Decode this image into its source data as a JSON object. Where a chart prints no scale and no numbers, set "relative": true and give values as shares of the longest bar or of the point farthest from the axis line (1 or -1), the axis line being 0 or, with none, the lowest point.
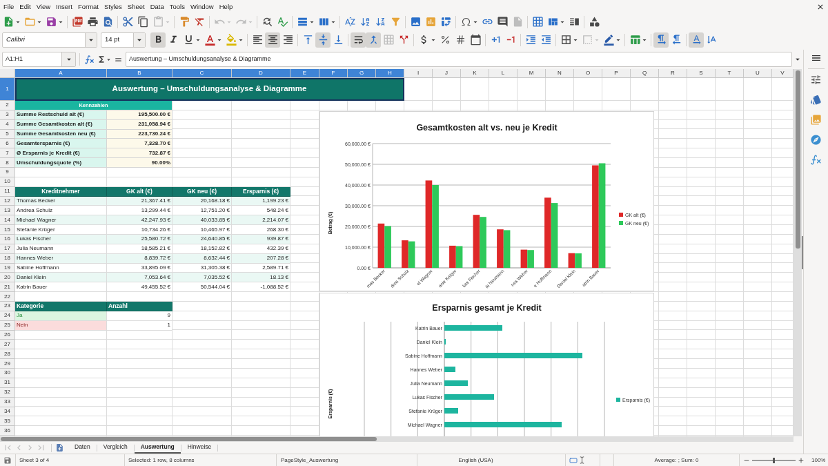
{
  "menu": [
    "File",
    "Edit",
    "View",
    "Insert",
    "Format",
    "Styles",
    "Sheet",
    "Data",
    "Tools",
    "Window",
    "Help"
  ],
  "standard_toolbar": {
    "paste_disabled": true,
    "undo_disabled": true,
    "redo_disabled": true,
    "headers_footers_disabled": true
  },
  "formatting_toolbar": {
    "font_name": "Calibri",
    "font_size": "14 pt",
    "bold": true,
    "italic": false,
    "underline": false,
    "align_left": false,
    "align_center": true,
    "align_right": false,
    "align_top": false,
    "align_middle": true,
    "align_bottom": false,
    "wrap_text": true,
    "merge_and_center": true,
    "merge_disabled": true,
    "border_style_disabled": true,
    "left_to_right": true,
    "right_to_left": false,
    "text_horizontal": true,
    "text_vertical": false
  },
  "formula_bar": {
    "name_box": "A1:H1",
    "content": "Auswertung – Umschuldungsanalyse & Diagramme"
  },
  "sheet": {
    "column_headers": [
      {
        "label": "A",
        "selected": true
      },
      {
        "label": "B",
        "selected": true
      },
      {
        "label": "C",
        "selected": true
      },
      {
        "label": "D",
        "selected": true
      },
      {
        "label": "E",
        "selected": true
      },
      {
        "label": "F",
        "selected": true
      },
      {
        "label": "G",
        "selected": true
      },
      {
        "label": "H",
        "selected": true
      },
      {
        "label": "I",
        "selected": false
      },
      {
        "label": "J",
        "selected": false
      },
      {
        "label": "K",
        "selected": false
      },
      {
        "label": "L",
        "selected": false
      },
      {
        "label": "M",
        "selected": false
      },
      {
        "label": "N",
        "selected": false
      },
      {
        "label": "O",
        "selected": false
      },
      {
        "label": "P",
        "selected": false
      },
      {
        "label": "Q",
        "selected": false
      },
      {
        "label": "R",
        "selected": false
      },
      {
        "label": "S",
        "selected": false
      },
      {
        "label": "T",
        "selected": false
      },
      {
        "label": "U",
        "selected": false
      },
      {
        "label": "V",
        "selected": false
      }
    ],
    "row_headers": [
      {
        "label": "1",
        "selected": true
      },
      {
        "label": "2",
        "selected": false
      },
      {
        "label": "3",
        "selected": false
      },
      {
        "label": "4",
        "selected": false
      },
      {
        "label": "5",
        "selected": false
      },
      {
        "label": "6",
        "selected": false
      },
      {
        "label": "7",
        "selected": false
      },
      {
        "label": "8",
        "selected": false
      },
      {
        "label": "9",
        "selected": false
      },
      {
        "label": "10",
        "selected": false
      },
      {
        "label": "11",
        "selected": false
      },
      {
        "label": "12",
        "selected": false
      },
      {
        "label": "13",
        "selected": false
      },
      {
        "label": "14",
        "selected": false
      },
      {
        "label": "15",
        "selected": false
      },
      {
        "label": "16",
        "selected": false
      },
      {
        "label": "17",
        "selected": false
      },
      {
        "label": "18",
        "selected": false
      },
      {
        "label": "19",
        "selected": false
      },
      {
        "label": "20",
        "selected": false
      },
      {
        "label": "21",
        "selected": false
      },
      {
        "label": "22",
        "selected": false
      },
      {
        "label": "23",
        "selected": false
      },
      {
        "label": "24",
        "selected": false
      },
      {
        "label": "25",
        "selected": false
      },
      {
        "label": "26",
        "selected": false
      },
      {
        "label": "27",
        "selected": false
      },
      {
        "label": "28",
        "selected": false
      },
      {
        "label": "29",
        "selected": false
      },
      {
        "label": "30",
        "selected": false
      },
      {
        "label": "31",
        "selected": false
      },
      {
        "label": "32",
        "selected": false
      },
      {
        "label": "33",
        "selected": false
      },
      {
        "label": "34",
        "selected": false
      },
      {
        "label": "35",
        "selected": false
      },
      {
        "label": "36",
        "selected": false
      }
    ],
    "title": "Auswertung – Umschuldungsanalyse & Diagramme",
    "key_figures": {
      "header": "Kennzahlen",
      "rows": [
        {
          "label": "Summe Restschuld alt (€)",
          "value": "195,500.00 €"
        },
        {
          "label": "Summe Gesamtkosten alt (€)",
          "value": "231,058.94 €"
        },
        {
          "label": "Summe Gesamtkosten neu (€)",
          "value": "223,730.24 €"
        },
        {
          "label": "Gesamtersparnis (€)",
          "value": "7,328.70 €"
        },
        {
          "label": "Ø Ersparnis je Kredit (€)",
          "value": "732.87 €"
        },
        {
          "label": "Umschuldungsquote (%)",
          "value": "90.00%"
        }
      ]
    },
    "loan_table": {
      "columns": [
        "Kreditnehmer",
        "GK alt (€)",
        "GK neu (€)",
        "Ersparnis (€)"
      ],
      "rows": [
        [
          "Thomas Becker",
          "21,367.41 €",
          "20,168.18 €",
          "1,199.23 €"
        ],
        [
          "Andrea Schulz",
          "13,299.44 €",
          "12,751.20 €",
          "548.24 €"
        ],
        [
          "Michael Wagner",
          "42,247.93 €",
          "40,033.85 €",
          "2,214.07 €"
        ],
        [
          "Stefanie Krüger",
          "10,734.26 €",
          "10,465.97 €",
          "268.30 €"
        ],
        [
          "Lukas Fischer",
          "25,580.72 €",
          "24,640.85 €",
          "939.87 €"
        ],
        [
          "Julia Neumann",
          "18,585.21 €",
          "18,152.82 €",
          "432.39 €"
        ],
        [
          "Hannes Weber",
          "8,839.72 €",
          "8,632.44 €",
          "207.28 €"
        ],
        [
          "Sabine Hoffmann",
          "33,895.09 €",
          "31,305.38 €",
          "2,589.71 €"
        ],
        [
          "Daniel Klein",
          "7,053.64 €",
          "7,035.52 €",
          "18.13 €"
        ],
        [
          "Katrin Bauer",
          "49,455.52 €",
          "50,544.04 €",
          "-1,088.52 €"
        ]
      ]
    },
    "category_table": {
      "columns": [
        "Kategorie",
        "Anzahl"
      ],
      "rows": [
        {
          "label": "Ja",
          "value": "9",
          "color": "#dcf5e1"
        },
        {
          "label": "Nein",
          "value": "1",
          "color": "#fbdcdc"
        }
      ]
    },
    "charts": [
      {
        "chart_data": {
          "type": "bar",
          "title": "Gesamtkosten alt vs. neu je Kredit",
          "ylabel": "Betrag (€)",
          "categories": [
            "mas Becker",
            "drea Schulz",
            "el Wagner",
            "anie Krüger",
            "kas Fischer",
            "ia Neumann",
            "nes Weber",
            "e Hoffmann",
            "Daniel Klein",
            "atrin Bauer"
          ],
          "series": [
            {
              "name": "GK alt (€)",
              "color": "#df2828",
              "values": [
                21400,
                13300,
                42200,
                10700,
                25600,
                18600,
                8800,
                33900,
                7100,
                49500
              ]
            },
            {
              "name": "GK neu (€)",
              "color": "#2ec95a",
              "values": [
                20200,
                12800,
                40000,
                10500,
                24600,
                18200,
                8600,
                31300,
                7000,
                50500
              ]
            }
          ],
          "ylim": [
            0,
            60000
          ],
          "yticks": [
            {
              "value": 0,
              "label": "0.00 €"
            },
            {
              "value": 10000,
              "label": "10,000.00 €"
            },
            {
              "value": 20000,
              "label": "20,000.00 €"
            },
            {
              "value": 30000,
              "label": "30,000.00 €"
            },
            {
              "value": 40000,
              "label": "40,000.00 €"
            },
            {
              "value": 50000,
              "label": "50,000.00 €"
            },
            {
              "value": 60000,
              "label": "60,000.00 €"
            }
          ],
          "grid": true,
          "legend": "right"
        }
      },
      {
        "chart_data": {
          "type": "bar",
          "orientation": "horizontal",
          "title": "Ersparnis gesamt je Kredit",
          "ylabel": "Ersparnis (€)",
          "categories": [
            "Katrin Bauer",
            "Daniel Klein",
            "Sabine Hoffmann",
            "Hannes Weber",
            "Julia Neumann",
            "Lukas Fischer",
            "Stefanie Krüger",
            "Michael Wagner"
          ],
          "series": [
            {
              "name": "Ersparnis (€)",
              "color": "#1db59f",
              "values": [
                0.42,
                0.01,
                1,
                0.08,
                0.17,
                0.36,
                0.1,
                0.85
              ]
            }
          ],
          "relative": true,
          "grid": true,
          "legend": "right"
        }
      }
    ]
  },
  "sheet_tabs": {
    "navigation_disabled": true,
    "tabs": [
      {
        "label": "Daten",
        "selected": false
      },
      {
        "label": "Vergleich",
        "selected": false
      },
      {
        "label": "Auswertung",
        "selected": true
      },
      {
        "label": "Hinweise",
        "selected": false
      }
    ]
  },
  "status_bar": {
    "sheet": "Sheet 3 of 4",
    "selection": "Selected: 1 row, 8 columns",
    "page_style": "PageStyle_Auswertung",
    "language": "English (USA)",
    "summary": "Average: ; Sum: 0",
    "zoom": "100%",
    "zoom_slider": {
      "level": 0.5
    }
  }
}
